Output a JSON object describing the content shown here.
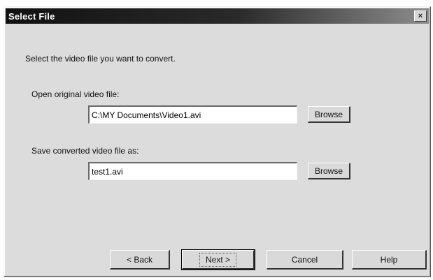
{
  "window": {
    "title": "Select File",
    "close_glyph": "×"
  },
  "instructions": "Select the video file you want to convert.",
  "open_section": {
    "label": "Open original video file:",
    "value": "C:\\MY Documents\\Video1.avi",
    "browse_label": "Browse"
  },
  "save_section": {
    "label": "Save converted video file as:",
    "value": "test1.avi",
    "browse_label": "Browse"
  },
  "footer": {
    "back_label": "< Back",
    "next_label": "Next >",
    "cancel_label": "Cancel",
    "help_label": "Help"
  }
}
